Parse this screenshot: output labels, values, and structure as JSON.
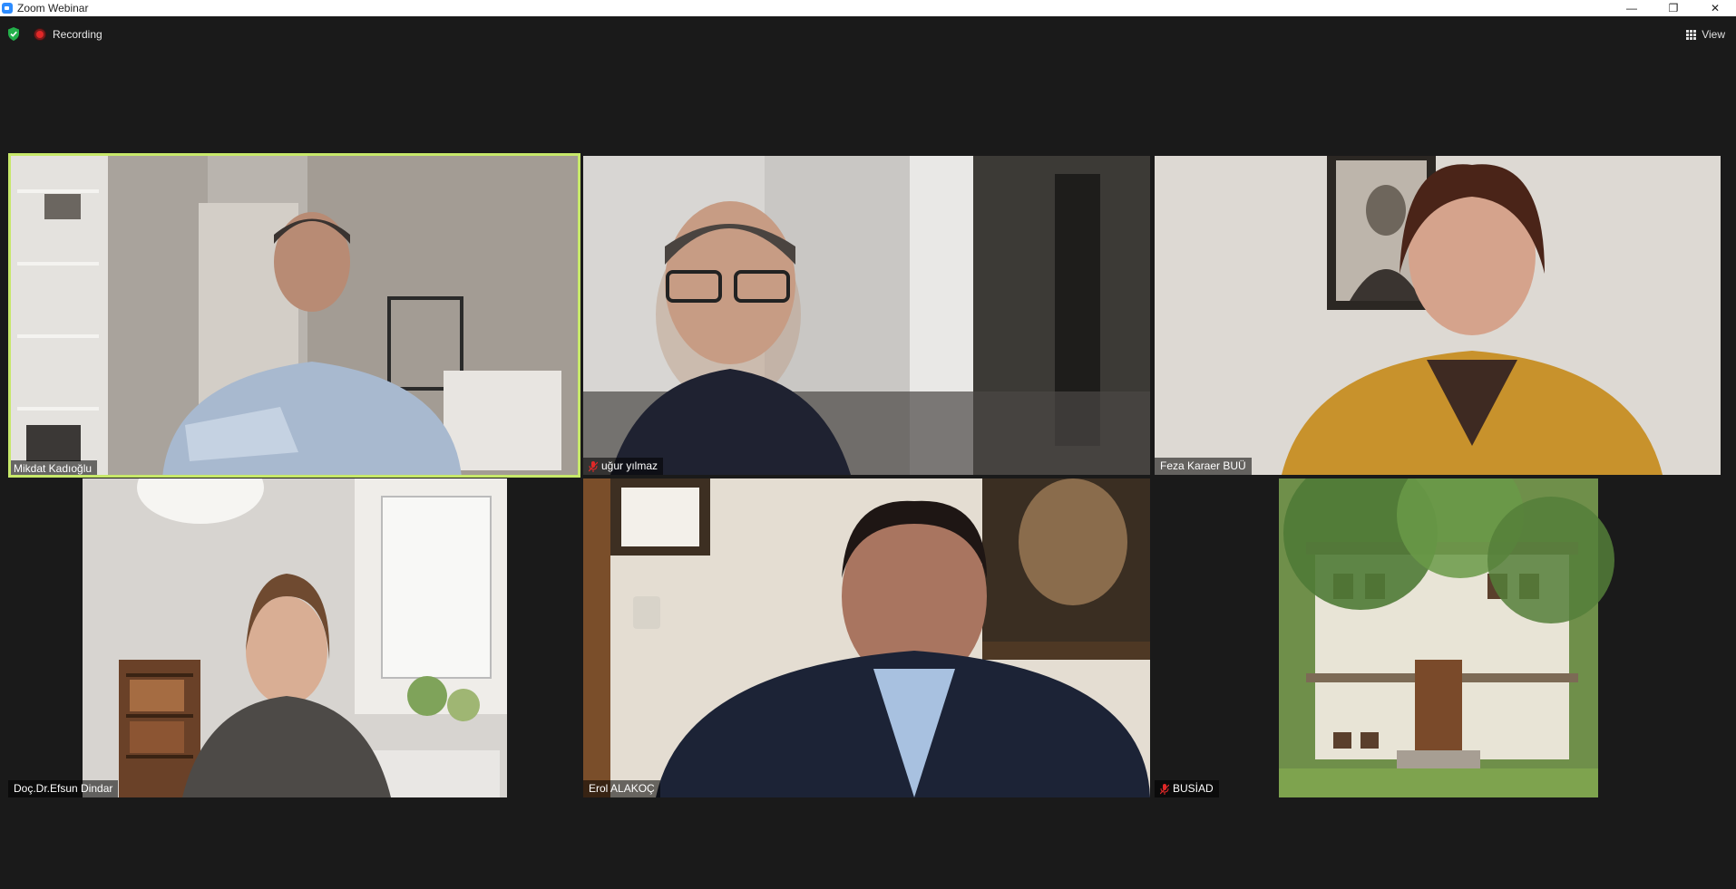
{
  "window": {
    "title": "Zoom Webinar",
    "controls": {
      "minimize": "—",
      "restore": "❐",
      "close": "✕"
    }
  },
  "toolbar": {
    "recording_label": "Recording",
    "view_label": "View",
    "colors": {
      "recording": "#e02828",
      "shield": "#23b04a"
    }
  },
  "participants": [
    {
      "name": "Mikdat Kadıoğlu",
      "muted": false,
      "active_speaker": true
    },
    {
      "name": "uğur yılmaz",
      "muted": true,
      "active_speaker": false
    },
    {
      "name": "Feza Karaer BUÜ",
      "muted": false,
      "active_speaker": false
    },
    {
      "name": "Doç.Dr.Efsun Dindar",
      "muted": false,
      "active_speaker": false
    },
    {
      "name": "Erol ALAKOÇ",
      "muted": false,
      "active_speaker": false
    },
    {
      "name": "BUSİAD",
      "muted": true,
      "active_speaker": false
    }
  ],
  "colors": {
    "active_speaker_border": "#c7e86a",
    "background": "#1a1a1a"
  }
}
